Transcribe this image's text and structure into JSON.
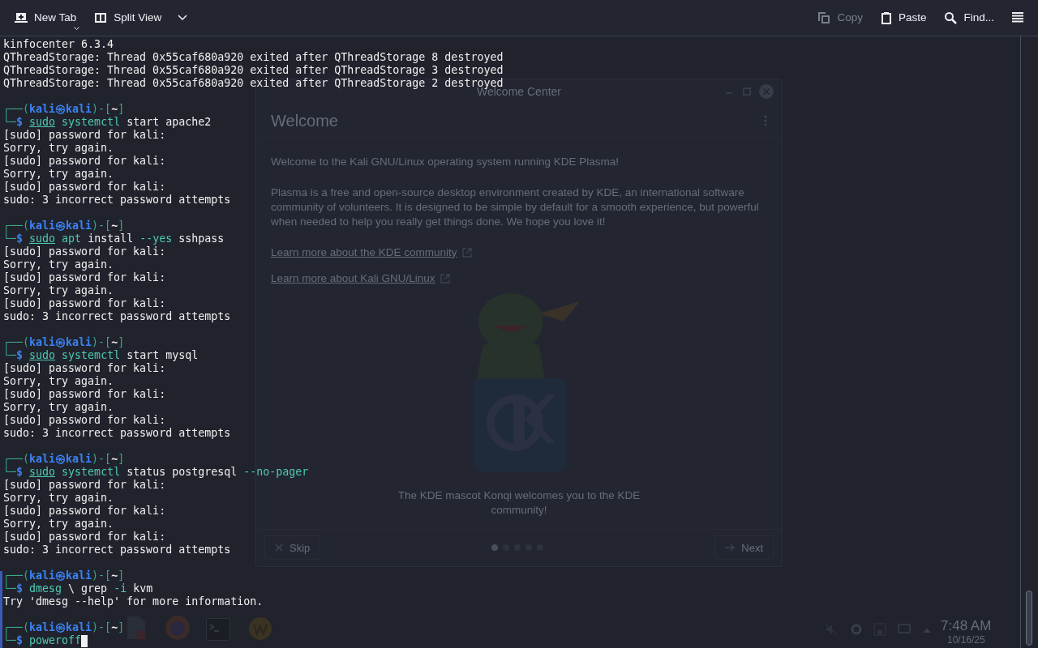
{
  "toolbar": {
    "left": [
      {
        "kind": "new_tab",
        "label": "New Tab",
        "disabled": false
      },
      {
        "kind": "split_view",
        "label": "Split View",
        "disabled": false
      }
    ],
    "right": [
      {
        "kind": "copy",
        "label": "Copy",
        "disabled": true
      },
      {
        "kind": "paste",
        "label": "Paste",
        "disabled": false
      },
      {
        "kind": "find",
        "label": "Find...",
        "disabled": false
      }
    ]
  },
  "background_window": {
    "title": "Welcome Center",
    "heading": "Welcome",
    "paragraphs": [
      "Welcome to the Kali GNU/Linux operating system running KDE Plasma!",
      "Plasma is a free and open-source desktop environment created by KDE, an international software community of volunteers. It is designed to be simple by default for a smooth experience, but powerful when needed to help you really get things done. We hope you love it!"
    ],
    "links": [
      "Learn more about the KDE community",
      "Learn more about Kali GNU/Linux"
    ],
    "caption": "The KDE mascot Konqi welcomes you to the KDE community!",
    "skip": "Skip",
    "next": "Next",
    "pages": [
      {
        "selected": true
      },
      {
        "selected": false
      },
      {
        "selected": false
      },
      {
        "selected": false
      },
      {
        "selected": false
      }
    ]
  },
  "taskbar": {
    "time": "7:48 AM",
    "date": "10/16/25"
  },
  "terminal": {
    "lines": [
      {
        "kind": "output",
        "text": "kinfocenter 6.3.4"
      },
      {
        "kind": "output",
        "text": "QThreadStorage: Thread 0x55caf680a920 exited after QThreadStorage 8 destroyed"
      },
      {
        "kind": "output",
        "text": "QThreadStorage: Thread 0x55caf680a920 exited after QThreadStorage 3 destroyed"
      },
      {
        "kind": "output",
        "text": "QThreadStorage: Thread 0x55caf680a920 exited after QThreadStorage 2 destroyed"
      },
      {
        "kind": "blank"
      },
      {
        "kind": "prompt",
        "open": "┌──(",
        "user": "kali",
        "at": "㉿",
        "host": "kali",
        "mid": ")-[",
        "dir": "~",
        "close": "]"
      },
      {
        "kind": "command",
        "corner": "└─",
        "sign": "$",
        "tokens": [
          {
            "kind": "sudo",
            "text": "sudo"
          },
          {
            "kind": "cmd",
            "text": "systemctl"
          },
          {
            "kind": "arg",
            "text": "start apache2"
          }
        ]
      },
      {
        "kind": "output",
        "text": "[sudo] password for kali:"
      },
      {
        "kind": "output",
        "text": "Sorry, try again."
      },
      {
        "kind": "output",
        "text": "[sudo] password for kali:"
      },
      {
        "kind": "output",
        "text": "Sorry, try again."
      },
      {
        "kind": "output",
        "text": "[sudo] password for kali:"
      },
      {
        "kind": "output",
        "text": "sudo: 3 incorrect password attempts"
      },
      {
        "kind": "blank"
      },
      {
        "kind": "prompt",
        "open": "┌──(",
        "user": "kali",
        "at": "㉿",
        "host": "kali",
        "mid": ")-[",
        "dir": "~",
        "close": "]"
      },
      {
        "kind": "command",
        "corner": "└─",
        "sign": "$",
        "tokens": [
          {
            "kind": "sudo",
            "text": "sudo"
          },
          {
            "kind": "cmd",
            "text": "apt"
          },
          {
            "kind": "arg",
            "text": "install"
          },
          {
            "kind": "opt",
            "text": "--yes"
          },
          {
            "kind": "arg",
            "text": "sshpass"
          }
        ]
      },
      {
        "kind": "output",
        "text": "[sudo] password for kali:"
      },
      {
        "kind": "output",
        "text": "Sorry, try again."
      },
      {
        "kind": "output",
        "text": "[sudo] password for kali:"
      },
      {
        "kind": "output",
        "text": "Sorry, try again."
      },
      {
        "kind": "output",
        "text": "[sudo] password for kali:"
      },
      {
        "kind": "output",
        "text": "sudo: 3 incorrect password attempts"
      },
      {
        "kind": "blank"
      },
      {
        "kind": "prompt",
        "open": "┌──(",
        "user": "kali",
        "at": "㉿",
        "host": "kali",
        "mid": ")-[",
        "dir": "~",
        "close": "]"
      },
      {
        "kind": "command",
        "corner": "└─",
        "sign": "$",
        "tokens": [
          {
            "kind": "sudo",
            "text": "sudo"
          },
          {
            "kind": "cmd",
            "text": "systemctl"
          },
          {
            "kind": "arg",
            "text": "start mysql"
          }
        ]
      },
      {
        "kind": "output",
        "text": "[sudo] password for kali:"
      },
      {
        "kind": "output",
        "text": "Sorry, try again."
      },
      {
        "kind": "output",
        "text": "[sudo] password for kali:"
      },
      {
        "kind": "output",
        "text": "Sorry, try again."
      },
      {
        "kind": "output",
        "text": "[sudo] password for kali:"
      },
      {
        "kind": "output",
        "text": "sudo: 3 incorrect password attempts"
      },
      {
        "kind": "blank"
      },
      {
        "kind": "prompt",
        "open": "┌──(",
        "user": "kali",
        "at": "㉿",
        "host": "kali",
        "mid": ")-[",
        "dir": "~",
        "close": "]"
      },
      {
        "kind": "command",
        "corner": "└─",
        "sign": "$",
        "tokens": [
          {
            "kind": "sudo",
            "text": "sudo"
          },
          {
            "kind": "cmd",
            "text": "systemctl"
          },
          {
            "kind": "arg",
            "text": "status postgresql"
          },
          {
            "kind": "opt",
            "text": "--no-pager"
          }
        ]
      },
      {
        "kind": "output",
        "text": "[sudo] password for kali:"
      },
      {
        "kind": "output",
        "text": "Sorry, try again."
      },
      {
        "kind": "output",
        "text": "[sudo] password for kali:"
      },
      {
        "kind": "output",
        "text": "Sorry, try again."
      },
      {
        "kind": "output",
        "text": "[sudo] password for kali:"
      },
      {
        "kind": "output",
        "text": "sudo: 3 incorrect password attempts"
      },
      {
        "kind": "blank"
      },
      {
        "kind": "prompt",
        "open": "┌──(",
        "user": "kali",
        "at": "㉿",
        "host": "kali",
        "mid": ")-[",
        "dir": "~",
        "close": "]"
      },
      {
        "kind": "command",
        "corner": "└─",
        "sign": "$",
        "tokens": [
          {
            "kind": "cmd",
            "text": "dmesg"
          },
          {
            "kind": "arg",
            "text": "\\ grep"
          },
          {
            "kind": "opt",
            "text": "-i"
          },
          {
            "kind": "arg",
            "text": "kvm"
          }
        ]
      },
      {
        "kind": "output",
        "text": "Try 'dmesg --help' for more information."
      },
      {
        "kind": "blank"
      },
      {
        "kind": "prompt",
        "open": "┌──(",
        "user": "kali",
        "at": "㉿",
        "host": "kali",
        "mid": ")-[",
        "dir": "~",
        "close": "]"
      },
      {
        "kind": "command",
        "corner": "└─",
        "sign": "$",
        "cursor": true,
        "tokens": [
          {
            "kind": "cmd",
            "text": "poweroff"
          }
        ]
      }
    ]
  }
}
